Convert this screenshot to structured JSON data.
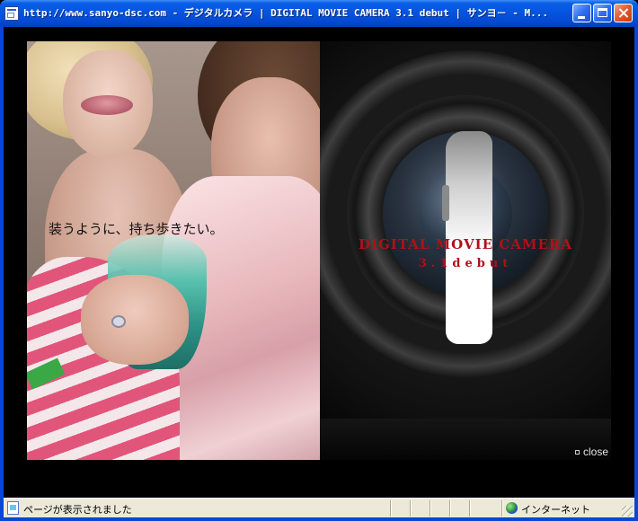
{
  "window": {
    "title": "http://www.sanyo-dsc.com - デジタルカメラ | DIGITAL MOVIE CAMERA 3.1 debut | サンヨ－ - M..."
  },
  "content": {
    "caption": "装うように、持ち歩きたい。",
    "product_title": "DIGITAL MOVIE CAMERA",
    "product_subtitle": "3.1debut",
    "close_label": "close"
  },
  "statusbar": {
    "status_text": "ページが表示されました",
    "zone_text": "インターネット"
  },
  "colors": {
    "title_bar": "#0554e0",
    "brand_red": "#b01018",
    "status_bar": "#ece9d8"
  },
  "icons": [
    "ie-page-icon",
    "minimize-icon",
    "maximize-icon",
    "close-icon",
    "page-status-icon",
    "globe-icon",
    "resize-grip-icon"
  ]
}
